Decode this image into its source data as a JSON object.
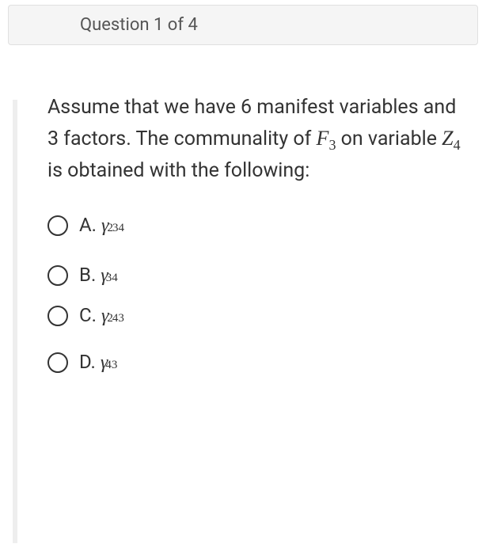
{
  "header": {
    "title": "Question 1 of 4"
  },
  "question": {
    "text_part1": "Assume that we have 6 manifest variables and 3 factors. The communality of ",
    "math1_base": "F",
    "math1_sub": "3",
    "text_part2": " on variable ",
    "math2_base": "Z",
    "math2_sub": "4",
    "text_part3": " is obtained with the following:"
  },
  "options": [
    {
      "prefix": "A.",
      "gamma": "γ",
      "sup": "2",
      "sub": "34"
    },
    {
      "prefix": "B.",
      "gamma": "γ",
      "sup": "",
      "sub": "34"
    },
    {
      "prefix": "C.",
      "gamma": "γ",
      "sup": "2",
      "sub": "43"
    },
    {
      "prefix": "D.",
      "gamma": "γ",
      "sup": "",
      "sub": "43"
    }
  ]
}
